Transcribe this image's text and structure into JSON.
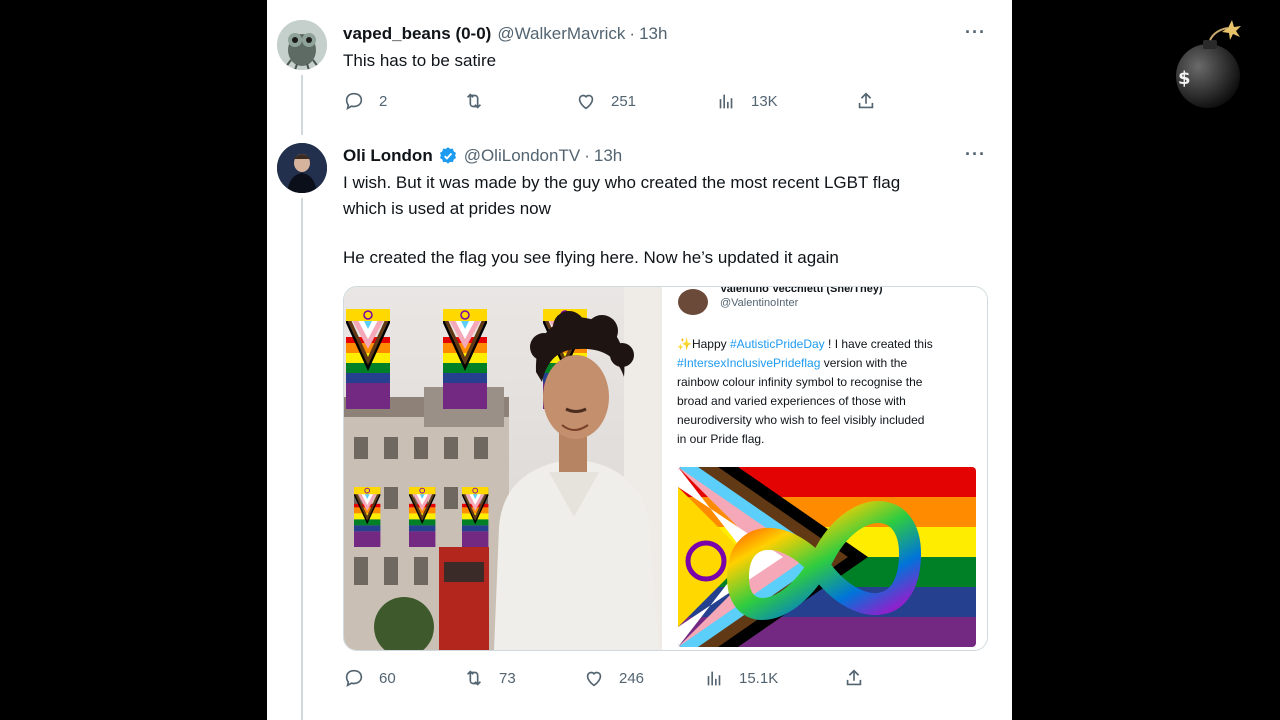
{
  "reply1": {
    "display_name": "vaped_beans (0-0)",
    "handle": "@WalkerMavrick",
    "time": "13h",
    "text": "This has to be satire",
    "replies": "2",
    "retweets": "",
    "likes": "251",
    "views": "13K",
    "more": "···"
  },
  "reply2": {
    "display_name": "Oli London",
    "handle": "@OliLondonTV",
    "time": "13h",
    "text_line1": "I wish. But it was made by the guy who created the most recent LGBT flag",
    "text_line2": "which is used at prides now",
    "text_line3": "He created the flag you see flying here. Now he’s updated it again",
    "replies": "60",
    "retweets": "73",
    "likes": "246",
    "views": "15.1K",
    "more": "···"
  },
  "embedded": {
    "name": "Valentino Vecchietti (She/They)",
    "handle": "@ValentinoInter",
    "body_line1_prefix": "✨Happy ",
    "body_line1_tag": "#AutisticPrideDay",
    "body_line1_suffix": " ! I have created this",
    "body_line2_tag": "#IntersexInclusivePrideflag",
    "body_line2_suffix": " version with the",
    "body_line3": "rainbow colour infinity symbol to recognise the",
    "body_line4": "broad and varied experiences of those with",
    "body_line5": "neurodiversity who wish to feel visibly included",
    "body_line6": "in our Pride flag."
  },
  "colors": {
    "link": "#1d9bf0",
    "muted": "#536471",
    "verified": "#1d9bf0"
  }
}
